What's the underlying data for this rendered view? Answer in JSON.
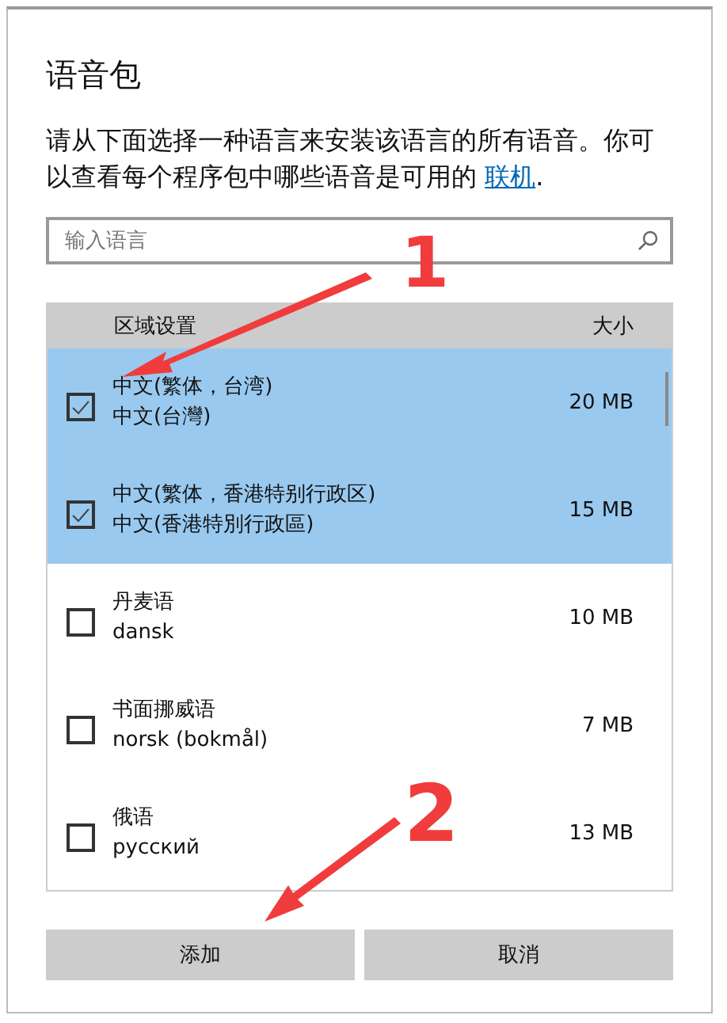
{
  "dialog": {
    "title": "语音包",
    "description": "请从下面选择一种语言来安装该语言的所有语音。你可以查看每个程序包中哪些语音是可用的",
    "link": "联机",
    "link_suffix": "."
  },
  "search": {
    "placeholder": "输入语言"
  },
  "table": {
    "columns": [
      "区域设置",
      "大小"
    ],
    "rows": [
      {
        "name": "中文(繁体，台湾)",
        "native": "中文(台灣)",
        "size": "20 MB",
        "checked": true,
        "selected": true
      },
      {
        "name": "中文(繁体，香港特别行政区)",
        "native": "中文(香港特別行政區)",
        "size": "15 MB",
        "checked": true,
        "selected": true
      },
      {
        "name": "丹麦语",
        "native": "dansk",
        "size": "10 MB",
        "checked": false,
        "selected": false
      },
      {
        "name": "书面挪威语",
        "native": "norsk (bokmål)",
        "size": "7 MB",
        "checked": false,
        "selected": false
      },
      {
        "name": "俄语",
        "native": "русский",
        "size": "13 MB",
        "checked": false,
        "selected": false
      }
    ]
  },
  "buttons": [
    "添加",
    "取消"
  ],
  "annotations": [
    {
      "label": "1"
    },
    {
      "label": "2"
    }
  ]
}
